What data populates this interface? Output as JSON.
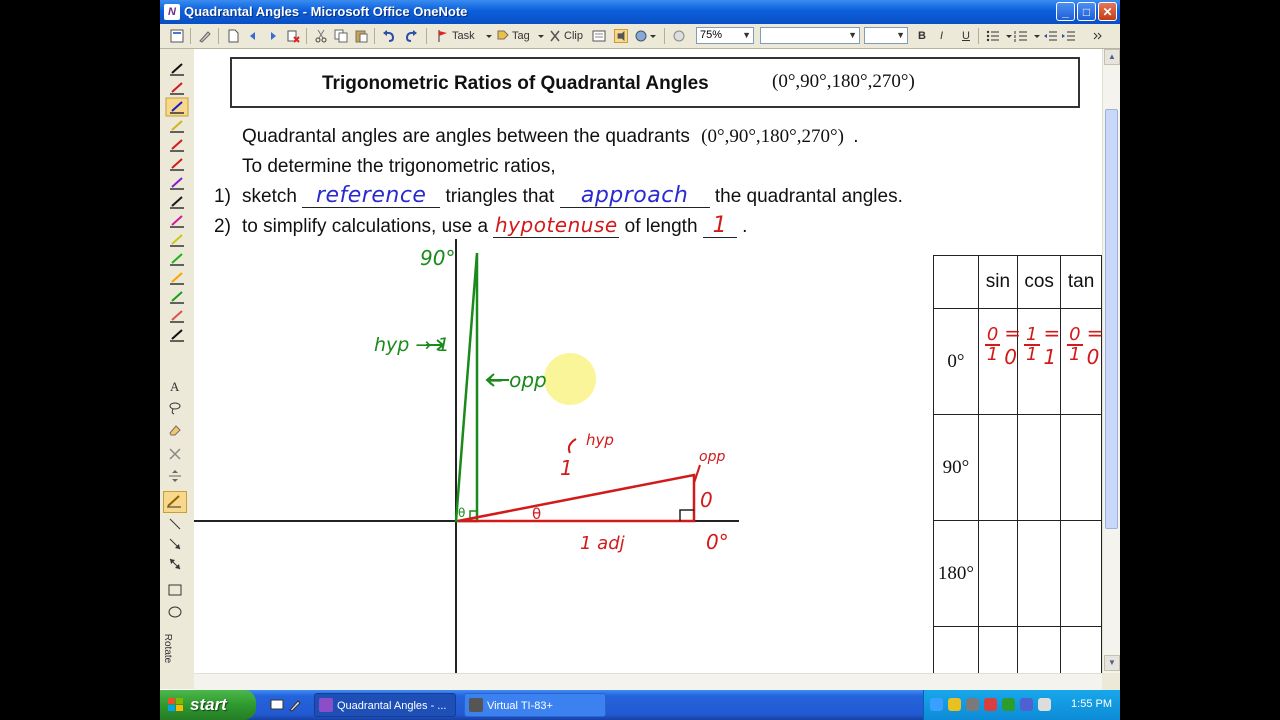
{
  "window": {
    "title": "Quadrantal Angles - Microsoft Office OneNote",
    "app_icon": "N",
    "minimize": "_",
    "maximize": "□",
    "close": "✕"
  },
  "toolbar": {
    "task_label": "Task",
    "tag_label": "Tag",
    "clip_label": "Clip",
    "zoom_value": "75%",
    "style_value": "",
    "size_value": "",
    "bold": "B",
    "italic": "I",
    "underline": "U"
  },
  "pen_toolbar": {
    "pen_colors": [
      "#111111",
      "#d21a1a",
      "#1a1ad2",
      "#d2b41a",
      "#d21a1a",
      "#d21a1a",
      "#8a1ad2",
      "#1a1a1a",
      "#d21a9c",
      "#c8c81a",
      "#1ab41a",
      "#ff9f00",
      "#1a9c1a",
      "#e05050",
      "#111111"
    ],
    "tools": [
      "text-tool",
      "lasso-tool",
      "eraser-tool",
      "delete-tool",
      "insert-space-tool",
      "pen-tool",
      "line-tool",
      "arrow-tool",
      "double-arrow-tool",
      "rectangle-tool",
      "ellipse-tool"
    ],
    "text_glyph": "A",
    "rotate_label": "Rotate"
  },
  "page": {
    "title": "Trigonometric Ratios of Quadrantal Angles",
    "title_angles": "(0°,90°,180°,270°)",
    "intro_text": "Quadrantal angles are angles between the quadrants",
    "intro_angles": "(0°,90°,180°,270°)",
    "intro_period": ".",
    "determine_text": "To determine the trigonometric ratios,",
    "step1_num": "1)",
    "step1_a": "sketch",
    "step1_blank1": "reference",
    "step1_b": "triangles that",
    "step1_blank2": "approach",
    "step1_c": "the quadrantal angles.",
    "step2_num": "2)",
    "step2_a": "to simplify calculations, use a",
    "step2_blank1": "hypotenuse",
    "step2_b": "of length",
    "step2_blank2": "1",
    "step2_c": "."
  },
  "diagram": {
    "label_90": "90°",
    "label_hyp_1": "hyp → 1",
    "label_opp_vertical": "← opp",
    "label_theta_small": "θ",
    "label_hyp_slanted": "hyp",
    "label_1": "1",
    "label_opp_right": "opp",
    "label_0_opp": "0",
    "label_theta": "θ",
    "label_1adj": "1 adj",
    "label_0deg": "0°"
  },
  "table": {
    "headers": [
      "",
      "sin",
      "cos",
      "tan"
    ],
    "rows": [
      {
        "angle": "0°",
        "sin": "0/1 = 0",
        "cos": "1/1 = 1",
        "tan": "0/1 = 0"
      },
      {
        "angle": "90°",
        "sin": "",
        "cos": "",
        "tan": ""
      },
      {
        "angle": "180°",
        "sin": "",
        "cos": "",
        "tan": ""
      }
    ]
  },
  "taskbar": {
    "start_label": "start",
    "tasks": [
      {
        "label": "Quadrantal Angles - ...",
        "active": true
      },
      {
        "label": "Virtual TI-83+",
        "active": false
      }
    ],
    "clock": "1:55 PM"
  }
}
